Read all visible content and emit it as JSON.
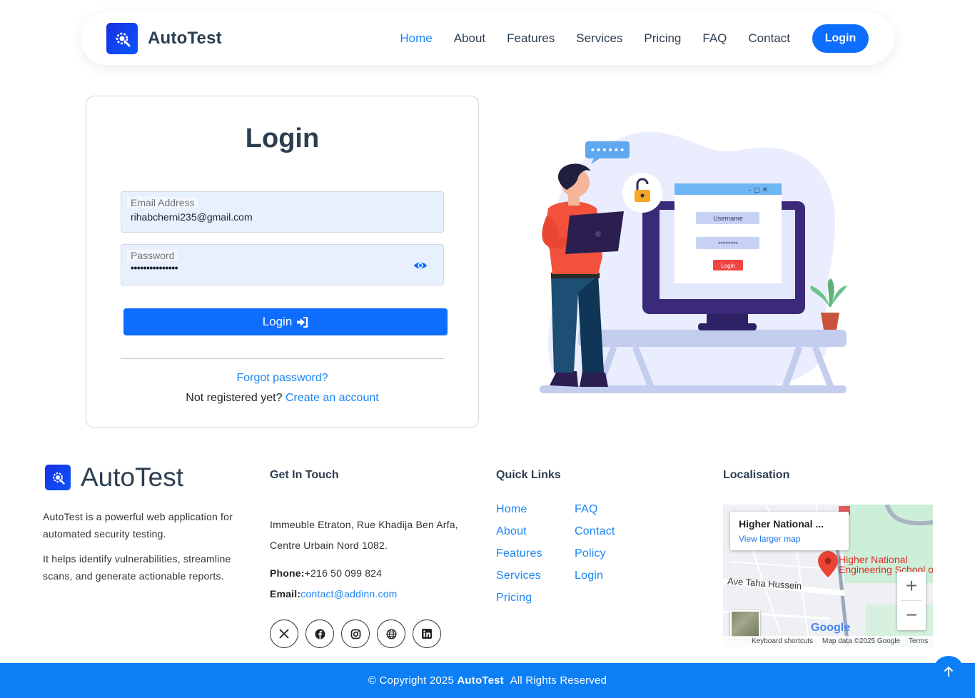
{
  "header": {
    "brand": "AutoTest",
    "nav": [
      "Home",
      "About",
      "Features",
      "Services",
      "Pricing",
      "FAQ",
      "Contact"
    ],
    "login": "Login"
  },
  "login_form": {
    "title": "Login",
    "email_label": "Email Address",
    "email_value": "rihabcherni235@gmail.com",
    "password_label": "Password",
    "password_mask": "•••••••••••••••",
    "submit_label": "Login",
    "forgot": "Forgot password?",
    "not_registered": "Not registered yet?",
    "create_account": "Create an account"
  },
  "illustration": {
    "username_field": "Username",
    "password_field": "********",
    "login_button": "Login"
  },
  "footer": {
    "brand": "AutoTest",
    "about_1": "AutoTest is a powerful web application for automated security testing.",
    "about_2": "It helps identify vulnerabilities, streamline scans, and generate actionable reports.",
    "get_in_touch": "Get In Touch",
    "address": "Immeuble Etraton, Rue Khadija Ben Arfa, Centre Urbain Nord 1082.",
    "phone_label": "Phone:",
    "phone": "+216 50 099 824",
    "email_label": "Email:",
    "email": "contact@addinn.com",
    "quick_links": "Quick Links",
    "links_col1": [
      "Home",
      "About",
      "Features",
      "Services",
      "Pricing"
    ],
    "links_col2": [
      "FAQ",
      "Contact",
      "Policy",
      "Login"
    ],
    "localisation": "Localisation",
    "socials": [
      "x-icon",
      "facebook-icon",
      "instagram-icon",
      "globe-icon",
      "linkedin-icon"
    ]
  },
  "map": {
    "card_title": "Higher National ...",
    "card_link": "View larger map",
    "place_line1": "Higher National",
    "place_line2": "Engineering School o",
    "street": "Ave Taha Hussein",
    "google": "Google",
    "shortcuts": "Keyboard shortcuts",
    "map_data": "Map data ©2025 Google",
    "terms": "Terms"
  },
  "copyright": {
    "prefix": "© Copyright 2025",
    "brand": "AutoTest",
    "suffix": "All Rights Reserved"
  },
  "colors": {
    "primary": "#0d6efd",
    "link": "#1b85f5",
    "heading": "#2c3e50",
    "footer_bar": "#0d7ff5"
  }
}
